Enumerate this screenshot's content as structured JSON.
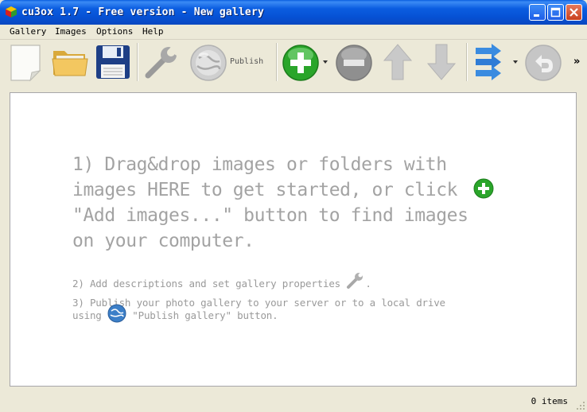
{
  "window": {
    "title": "cu3ox 1.7 - Free version - New gallery",
    "minimize_icon": "minimize-icon",
    "maximize_icon": "maximize-icon",
    "close_icon": "close-icon"
  },
  "menu": {
    "items": [
      {
        "label": "Gallery"
      },
      {
        "label": "Images"
      },
      {
        "label": "Options"
      },
      {
        "label": "Help"
      }
    ]
  },
  "toolbar": {
    "publish_label": "Publish",
    "buttons": [
      {
        "name": "new-gallery",
        "icon": "new-document-icon"
      },
      {
        "name": "open-gallery",
        "icon": "folder-icon"
      },
      {
        "name": "save-gallery",
        "icon": "floppy-disk-icon"
      },
      {
        "name": "properties",
        "icon": "wrench-icon"
      },
      {
        "name": "publish",
        "icon": "globe-icon"
      },
      {
        "name": "add-images",
        "icon": "plus-icon"
      },
      {
        "name": "remove-image",
        "icon": "minus-icon"
      },
      {
        "name": "move-up",
        "icon": "arrow-up-icon"
      },
      {
        "name": "move-down",
        "icon": "arrow-down-icon"
      },
      {
        "name": "transitions",
        "icon": "arrows-icon"
      },
      {
        "name": "undo",
        "icon": "undo-icon"
      }
    ],
    "more": "»"
  },
  "instructions": {
    "step1_line1": "1) Drag&drop images or folders with",
    "step1_line2": "images HERE to get started, or click",
    "step1_line3": "\"Add images...\" button to find images",
    "step1_line4": "on your computer.",
    "step2": "2) Add descriptions and set gallery properties",
    "step2_end": ".",
    "step3_line1": "3) Publish your photo gallery to your server or to a local drive",
    "step3_using": "using",
    "step3_rest": "\"Publish gallery\" button."
  },
  "status": {
    "items": "0 items"
  },
  "colors": {
    "titlebar": "#0b5de0",
    "add_green": "#2aa52a",
    "remove_gray": "#8f8f8f"
  }
}
